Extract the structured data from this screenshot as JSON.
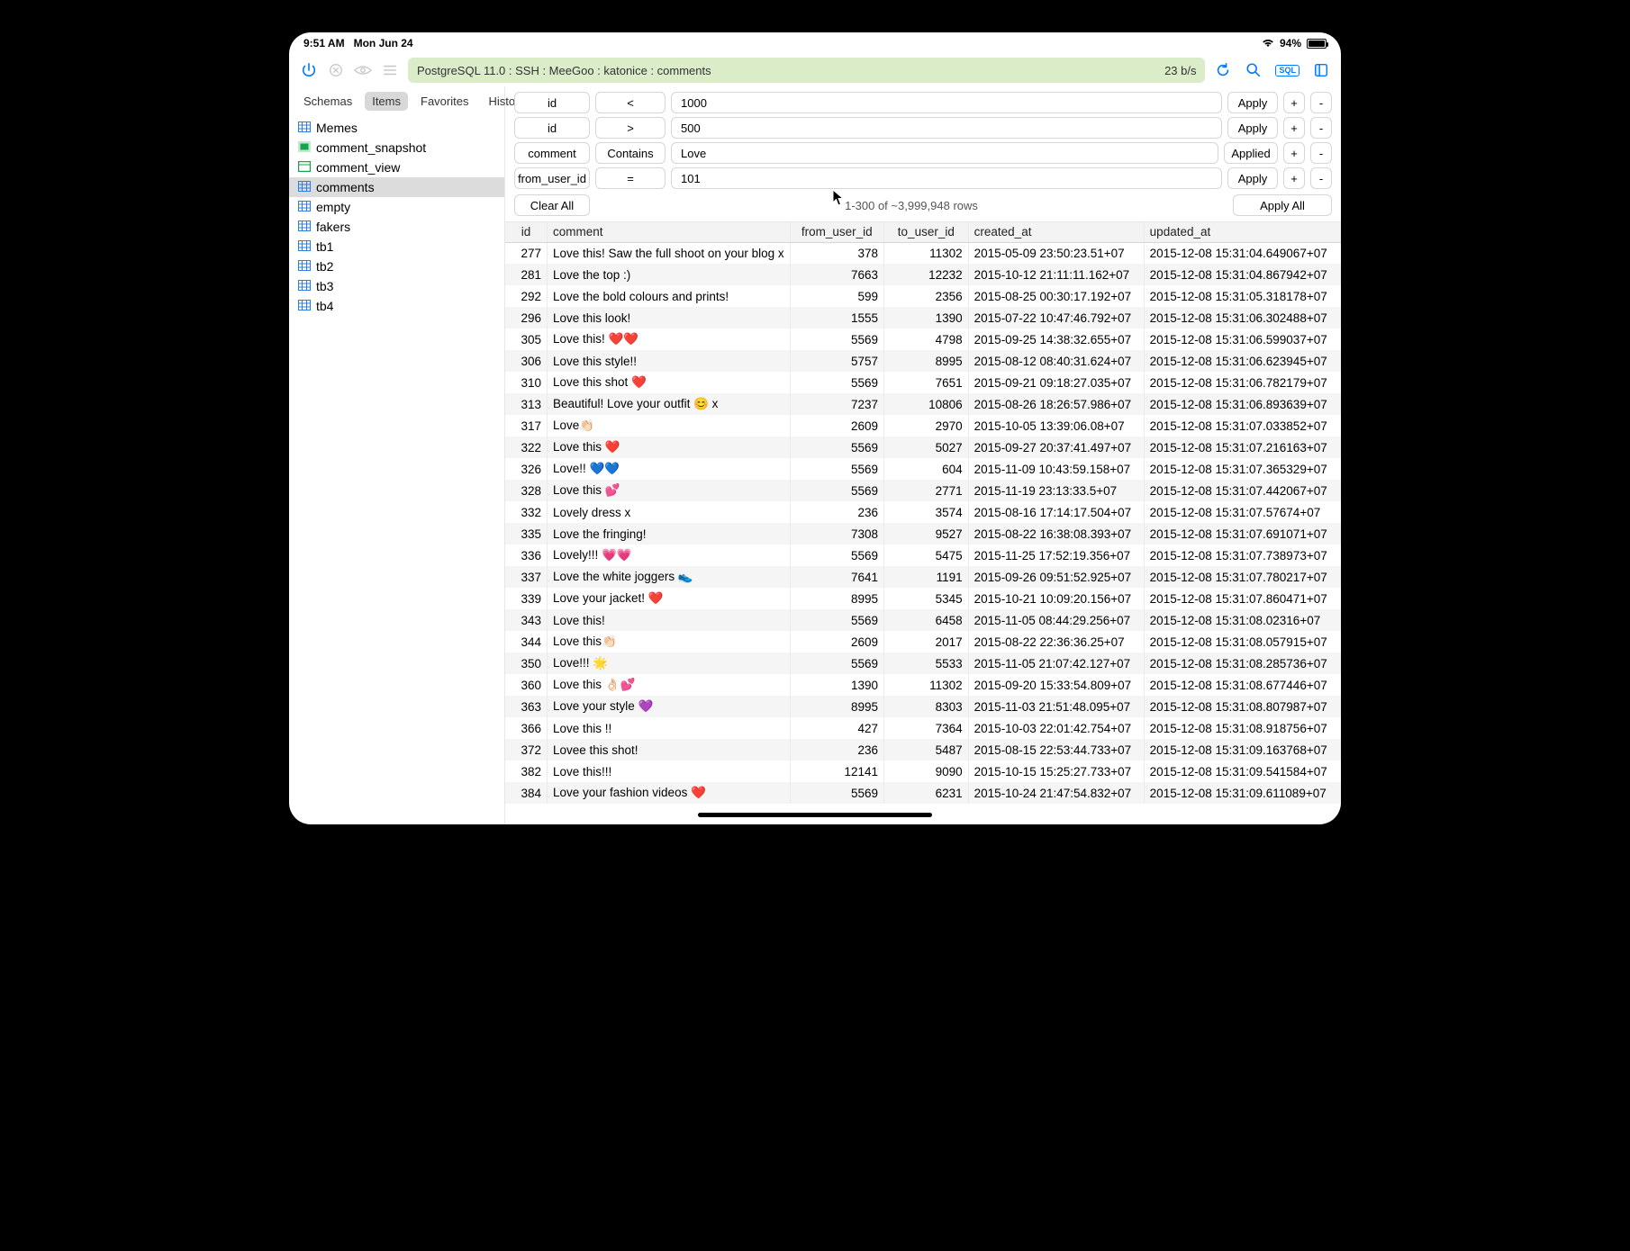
{
  "status": {
    "time": "9:51 AM",
    "date": "Mon Jun 24",
    "battery_pct": "94%"
  },
  "breadcrumb": "PostgreSQL 11.0 : SSH : MeeGoo : katonice : comments",
  "transfer_rate": "23 b/s",
  "sidebar": {
    "tabs": [
      "Schemas",
      "Items",
      "Favorites",
      "History"
    ],
    "active_tab": "Items",
    "items": [
      {
        "name": "Memes",
        "kind": "table"
      },
      {
        "name": "comment_snapshot",
        "kind": "snapshot"
      },
      {
        "name": "comment_view",
        "kind": "view"
      },
      {
        "name": "comments",
        "kind": "table",
        "selected": true
      },
      {
        "name": "empty",
        "kind": "table"
      },
      {
        "name": "fakers",
        "kind": "table"
      },
      {
        "name": "tb1",
        "kind": "table"
      },
      {
        "name": "tb2",
        "kind": "table"
      },
      {
        "name": "tb3",
        "kind": "table"
      },
      {
        "name": "tb4",
        "kind": "table"
      }
    ]
  },
  "filters": [
    {
      "column": "id",
      "op": "<",
      "value": "1000",
      "button": "Apply"
    },
    {
      "column": "id",
      "op": ">",
      "value": "500",
      "button": "Apply"
    },
    {
      "column": "comment",
      "op": "Contains",
      "value": "Love",
      "button": "Applied"
    },
    {
      "column": "from_user_id",
      "op": "=",
      "value": "101",
      "button": "Apply"
    }
  ],
  "filter_buttons": {
    "plus": "+",
    "minus": "-",
    "clear_all": "Clear All",
    "apply_all": "Apply All"
  },
  "row_summary": "1-300 of ~3,999,948 rows",
  "columns": [
    "id",
    "comment",
    "from_user_id",
    "to_user_id",
    "created_at",
    "updated_at"
  ],
  "rows": [
    {
      "id": "277",
      "comment": "Love this! Saw the full shoot on your blog x",
      "from": "378",
      "to": "11302",
      "created": "2015-05-09 23:50:23.51+07",
      "updated": "2015-12-08 15:31:04.649067+07"
    },
    {
      "id": "281",
      "comment": "Love the top :)",
      "from": "7663",
      "to": "12232",
      "created": "2015-10-12 21:11:11.162+07",
      "updated": "2015-12-08 15:31:04.867942+07"
    },
    {
      "id": "292",
      "comment": "Love the bold colours and prints!",
      "from": "599",
      "to": "2356",
      "created": "2015-08-25 00:30:17.192+07",
      "updated": "2015-12-08 15:31:05.318178+07"
    },
    {
      "id": "296",
      "comment": "Love this look!",
      "from": "1555",
      "to": "1390",
      "created": "2015-07-22 10:47:46.792+07",
      "updated": "2015-12-08 15:31:06.302488+07"
    },
    {
      "id": "305",
      "comment": "Love this! ❤️❤️",
      "from": "5569",
      "to": "4798",
      "created": "2015-09-25 14:38:32.655+07",
      "updated": "2015-12-08 15:31:06.599037+07"
    },
    {
      "id": "306",
      "comment": "Love this style!!",
      "from": "5757",
      "to": "8995",
      "created": "2015-08-12 08:40:31.624+07",
      "updated": "2015-12-08 15:31:06.623945+07"
    },
    {
      "id": "310",
      "comment": "Love this shot ❤️",
      "from": "5569",
      "to": "7651",
      "created": "2015-09-21 09:18:27.035+07",
      "updated": "2015-12-08 15:31:06.782179+07"
    },
    {
      "id": "313",
      "comment": "Beautiful! Love your outfit 😊 x",
      "from": "7237",
      "to": "10806",
      "created": "2015-08-26 18:26:57.986+07",
      "updated": "2015-12-08 15:31:06.893639+07"
    },
    {
      "id": "317",
      "comment": " Love👏🏻",
      "from": "2609",
      "to": "2970",
      "created": "2015-10-05 13:39:06.08+07",
      "updated": "2015-12-08 15:31:07.033852+07"
    },
    {
      "id": "322",
      "comment": "Love this ❤️",
      "from": "5569",
      "to": "5027",
      "created": "2015-09-27 20:37:41.497+07",
      "updated": "2015-12-08 15:31:07.216163+07"
    },
    {
      "id": "326",
      "comment": "Love!! 💙💙",
      "from": "5569",
      "to": "604",
      "created": "2015-11-09 10:43:59.158+07",
      "updated": "2015-12-08 15:31:07.365329+07"
    },
    {
      "id": "328",
      "comment": "Love this 💕",
      "from": "5569",
      "to": "2771",
      "created": "2015-11-19 23:13:33.5+07",
      "updated": "2015-12-08 15:31:07.442067+07"
    },
    {
      "id": "332",
      "comment": "Lovely dress x",
      "from": "236",
      "to": "3574",
      "created": "2015-08-16 17:14:17.504+07",
      "updated": "2015-12-08 15:31:07.57674+07"
    },
    {
      "id": "335",
      "comment": "Love the fringing!",
      "from": "7308",
      "to": "9527",
      "created": "2015-08-22 16:38:08.393+07",
      "updated": "2015-12-08 15:31:07.691071+07"
    },
    {
      "id": "336",
      "comment": "Lovely!!! 💗💗",
      "from": "5569",
      "to": "5475",
      "created": "2015-11-25 17:52:19.356+07",
      "updated": "2015-12-08 15:31:07.738973+07"
    },
    {
      "id": "337",
      "comment": "Love the white joggers 👟",
      "from": "7641",
      "to": "1191",
      "created": "2015-09-26 09:51:52.925+07",
      "updated": "2015-12-08 15:31:07.780217+07"
    },
    {
      "id": "339",
      "comment": "Love your jacket! ❤️",
      "from": "8995",
      "to": "5345",
      "created": "2015-10-21 10:09:20.156+07",
      "updated": "2015-12-08 15:31:07.860471+07"
    },
    {
      "id": "343",
      "comment": "Love this!",
      "from": "5569",
      "to": "6458",
      "created": "2015-11-05 08:44:29.256+07",
      "updated": "2015-12-08 15:31:08.02316+07"
    },
    {
      "id": "344",
      "comment": "Love this👏🏻",
      "from": "2609",
      "to": "2017",
      "created": "2015-08-22 22:36:36.25+07",
      "updated": "2015-12-08 15:31:08.057915+07"
    },
    {
      "id": "350",
      "comment": "Love!!! 🌟",
      "from": "5569",
      "to": "5533",
      "created": "2015-11-05 21:07:42.127+07",
      "updated": "2015-12-08 15:31:08.285736+07"
    },
    {
      "id": "360",
      "comment": "Love this 👌🏻💕",
      "from": "1390",
      "to": "11302",
      "created": "2015-09-20 15:33:54.809+07",
      "updated": "2015-12-08 15:31:08.677446+07"
    },
    {
      "id": "363",
      "comment": "Love your style 💜",
      "from": "8995",
      "to": "8303",
      "created": "2015-11-03 21:51:48.095+07",
      "updated": "2015-12-08 15:31:08.807987+07"
    },
    {
      "id": "366",
      "comment": "Love this !!",
      "from": "427",
      "to": "7364",
      "created": "2015-10-03 22:01:42.754+07",
      "updated": "2015-12-08 15:31:08.918756+07"
    },
    {
      "id": "372",
      "comment": "Lovee this shot!",
      "from": "236",
      "to": "5487",
      "created": "2015-08-15 22:53:44.733+07",
      "updated": "2015-12-08 15:31:09.163768+07"
    },
    {
      "id": "382",
      "comment": "Love this!!!",
      "from": "12141",
      "to": "9090",
      "created": "2015-10-15 15:25:27.733+07",
      "updated": "2015-12-08 15:31:09.541584+07"
    },
    {
      "id": "384",
      "comment": "Love your fashion videos ❤️",
      "from": "5569",
      "to": "6231",
      "created": "2015-10-24 21:47:54.832+07",
      "updated": "2015-12-08 15:31:09.611089+07"
    }
  ]
}
